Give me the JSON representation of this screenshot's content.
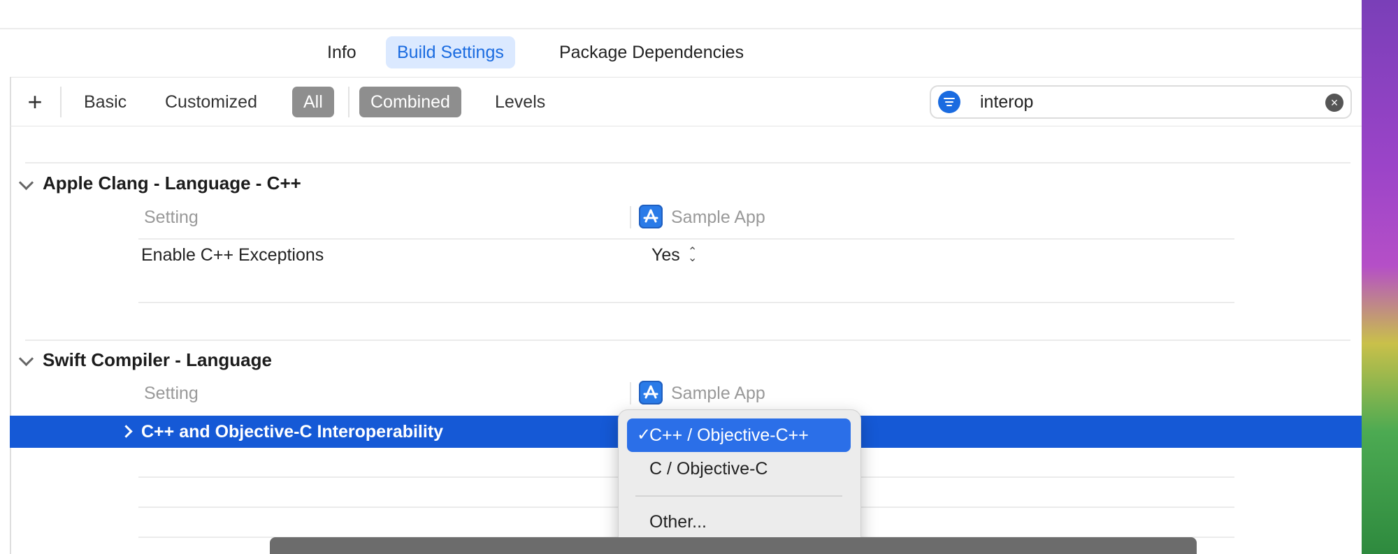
{
  "tabs": [
    {
      "label": "Info"
    },
    {
      "label": "Build Settings"
    },
    {
      "label": "Package Dependencies"
    }
  ],
  "filters": {
    "add": "+",
    "items": [
      {
        "label": "Basic"
      },
      {
        "label": "Customized"
      },
      {
        "label": "All"
      },
      {
        "label": "Combined"
      },
      {
        "label": "Levels"
      }
    ]
  },
  "search": {
    "value": "interop",
    "clear": "×"
  },
  "groups": [
    {
      "title": "Apple Clang - Language - C++",
      "column_setting": "Setting",
      "column_target": "Sample App",
      "rows": [
        {
          "setting": "Enable C++ Exceptions",
          "value": "Yes"
        }
      ]
    },
    {
      "title": "Swift Compiler - Language",
      "column_setting": "Setting",
      "column_target": "Sample App",
      "rows": [
        {
          "setting": "C++ and Objective-C Interoperability"
        }
      ]
    }
  ],
  "popup": {
    "items": [
      {
        "label": "C++ / Objective-C++",
        "checked": true,
        "check": "✓"
      },
      {
        "label": "C / Objective-C"
      },
      {
        "label": "Other..."
      }
    ]
  },
  "colors": {
    "accent": "#1a6be0",
    "selection": "#1559d6"
  }
}
